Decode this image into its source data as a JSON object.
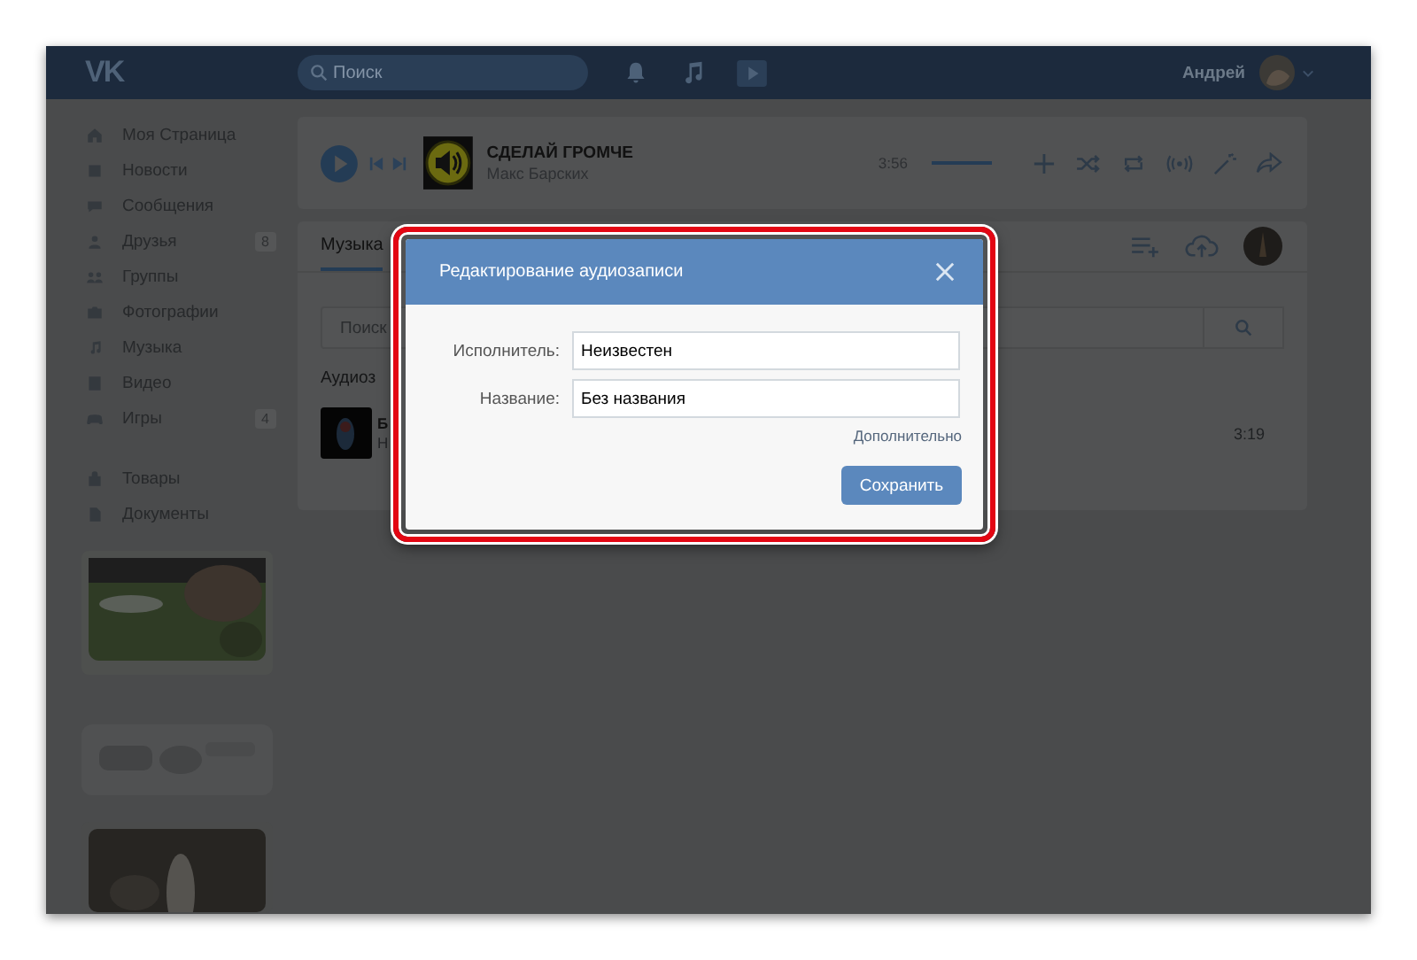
{
  "header": {
    "logo": "VK",
    "search": {
      "placeholder": "Поиск"
    },
    "user": {
      "name": "Андрей"
    }
  },
  "sidebar": {
    "items": [
      {
        "label": "Моя Страница"
      },
      {
        "label": "Новости"
      },
      {
        "label": "Сообщения"
      },
      {
        "label": "Друзья",
        "badge": "8"
      },
      {
        "label": "Группы"
      },
      {
        "label": "Фотографии"
      },
      {
        "label": "Музыка"
      },
      {
        "label": "Видео"
      },
      {
        "label": "Игры",
        "badge": "4"
      }
    ],
    "items2": [
      {
        "label": "Товары"
      },
      {
        "label": "Документы"
      }
    ]
  },
  "player": {
    "title": "СДЕЛАЙ ГРОМЧЕ",
    "artist": "Макс Барских",
    "time": "3:56",
    "volume": {
      "level": 1
    }
  },
  "music": {
    "tabs": [
      {
        "label": "Музыка",
        "selected": true
      }
    ],
    "search": {
      "placeholder": "Поиск"
    },
    "section": "Аудиоз",
    "tracks": [
      {
        "title": "Б",
        "artist": "Н",
        "duration": "3:19"
      }
    ]
  },
  "dialog": {
    "title": "Редактирование аудиозаписи",
    "fields": [
      {
        "label": "Исполнитель:",
        "value": "Неизвестен"
      },
      {
        "label": "Название:",
        "value": "Без названия"
      }
    ],
    "link": "Дополнительно",
    "button": "Сохранить"
  }
}
